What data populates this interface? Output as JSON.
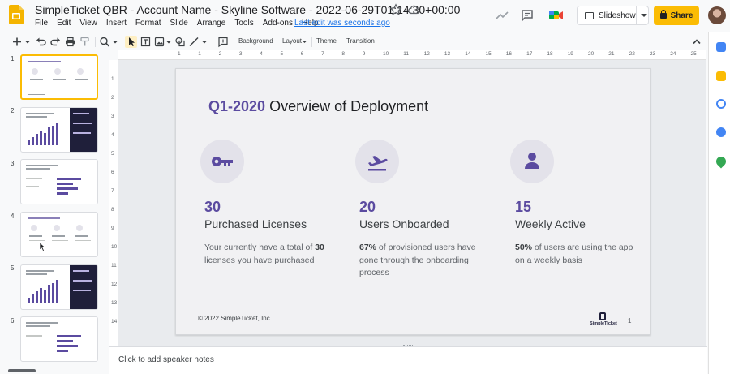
{
  "header": {
    "doc_title": "SimpleTicket QBR - Account Name - Skyline Software - 2022-06-29T01:14:30+00:00",
    "last_edit": "Last edit was seconds ago",
    "slideshow_label": "Slideshow",
    "share_label": "Share"
  },
  "menu": [
    "File",
    "Edit",
    "View",
    "Insert",
    "Format",
    "Slide",
    "Arrange",
    "Tools",
    "Add-ons",
    "Help"
  ],
  "toolbar": {
    "background_label": "Background",
    "layout_label": "Layout",
    "theme_label": "Theme",
    "transition_label": "Transition"
  },
  "ruler_h": [
    "1",
    "1",
    "2",
    "3",
    "4",
    "5",
    "6",
    "7",
    "8",
    "9",
    "10",
    "11",
    "12",
    "13",
    "14",
    "15",
    "16",
    "17",
    "18",
    "19",
    "20",
    "21",
    "22",
    "23",
    "24",
    "25"
  ],
  "ruler_v": [
    "1",
    "2",
    "3",
    "4",
    "5",
    "6",
    "7",
    "8",
    "9",
    "10",
    "11",
    "12",
    "13",
    "14"
  ],
  "filmstrip": {
    "numbers": [
      "1",
      "2",
      "3",
      "4",
      "5",
      "6"
    ]
  },
  "slide": {
    "title_accent": "Q1-2020",
    "title_rest": " Overview of Deployment",
    "metrics": [
      {
        "number": "30",
        "label": "Purchased Licenses",
        "desc_pre": "Your currently have a total of ",
        "desc_bold": "30",
        "desc_post": " licenses you have purchased",
        "icon": "key-icon"
      },
      {
        "number": "20",
        "label": "Users Onboarded",
        "desc_pre": "",
        "desc_bold": "67%",
        "desc_post": " of provisioned users have gone through the onboarding process",
        "icon": "airplane-takeoff-icon"
      },
      {
        "number": "15",
        "label": "Weekly Active",
        "desc_pre": "",
        "desc_bold": "50%",
        "desc_post": " of users are using the app on a weekly basis",
        "icon": "person-icon"
      }
    ],
    "footer": "© 2022 SimpleTicket, Inc.",
    "logo_text": "SimpleTicket",
    "page_number": "1"
  },
  "notes_placeholder": "Click to add speaker notes",
  "colors": {
    "accent": "#5b4ba0",
    "share_button": "#fbbc04",
    "link": "#1a73e8"
  }
}
